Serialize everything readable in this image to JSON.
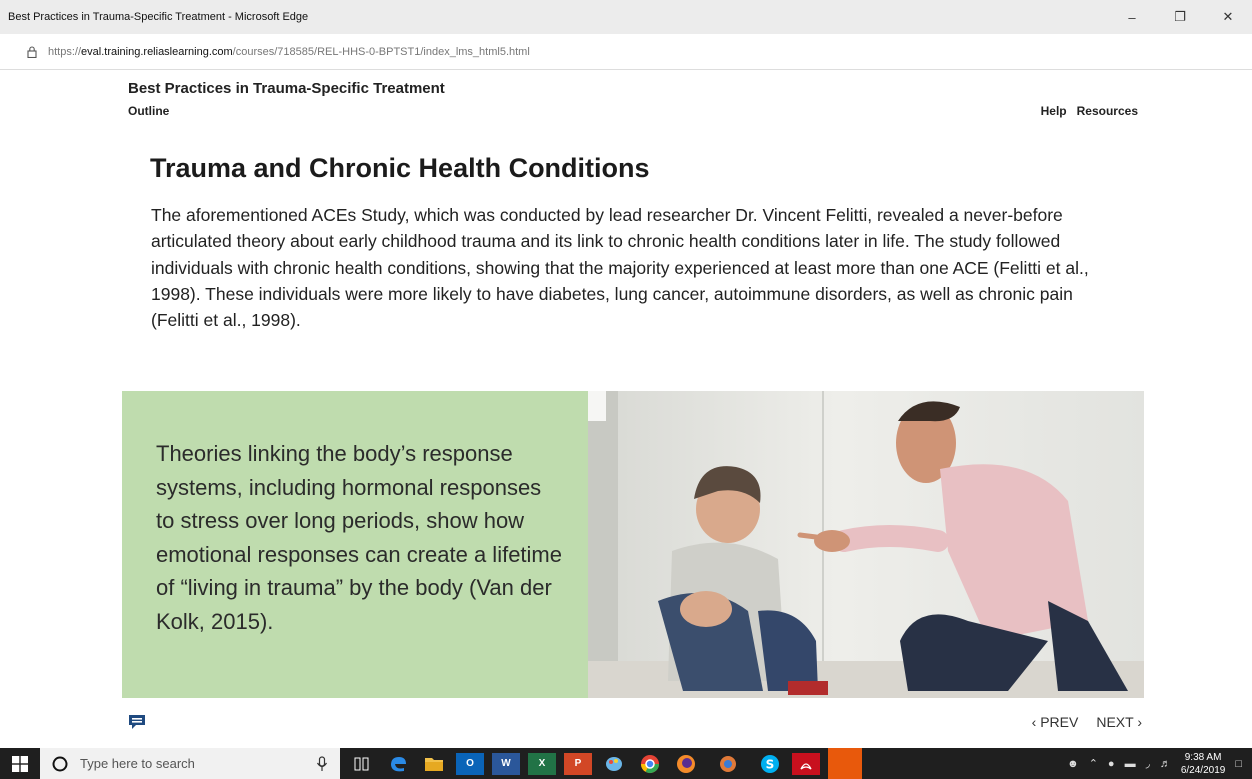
{
  "browser": {
    "window_title": "Best Practices in Trauma-Specific Treatment - Microsoft Edge",
    "url_prefix": "https://",
    "url_domain": "eval.training.reliaslearning.com",
    "url_path": "/courses/718585/REL-HHS-0-BPTST1/index_lms_html5.html",
    "controls": {
      "minimize": "–",
      "restore": "❐",
      "close": "✕"
    }
  },
  "course": {
    "title": "Best Practices in Trauma-Specific Treatment",
    "outline": "Outline",
    "help": "Help",
    "resources": "Resources"
  },
  "slide": {
    "heading": "Trauma and Chronic Health Conditions",
    "paragraph": "The aforementioned ACEs Study, which was conducted by lead researcher Dr. Vincent Felitti, revealed a never-before articulated theory about early childhood trauma and its link to chronic health conditions later in life. The study followed individuals with chronic health conditions, showing that the majority experienced at least more than one ACE (Felitti et al., 1998). These individuals were more likely to have diabetes, lung cancer, autoimmune disorders, as well as chronic pain (Felitti et al., 1998).",
    "quote": "Theories linking the body’s response systems, including hormonal responses to stress over long periods, show how emotional responses can create a lifetime of “living in trauma” by the body (Van der Kolk, 2015)."
  },
  "pager": {
    "prev": "‹ PREV",
    "next": "NEXT ›"
  },
  "taskbar": {
    "search_placeholder": "Type here to search",
    "time": "9:38 AM",
    "date": "6/24/2019"
  },
  "colors": {
    "quote_bg": "#bfdcae",
    "taskbar": "#1f1f1f"
  }
}
